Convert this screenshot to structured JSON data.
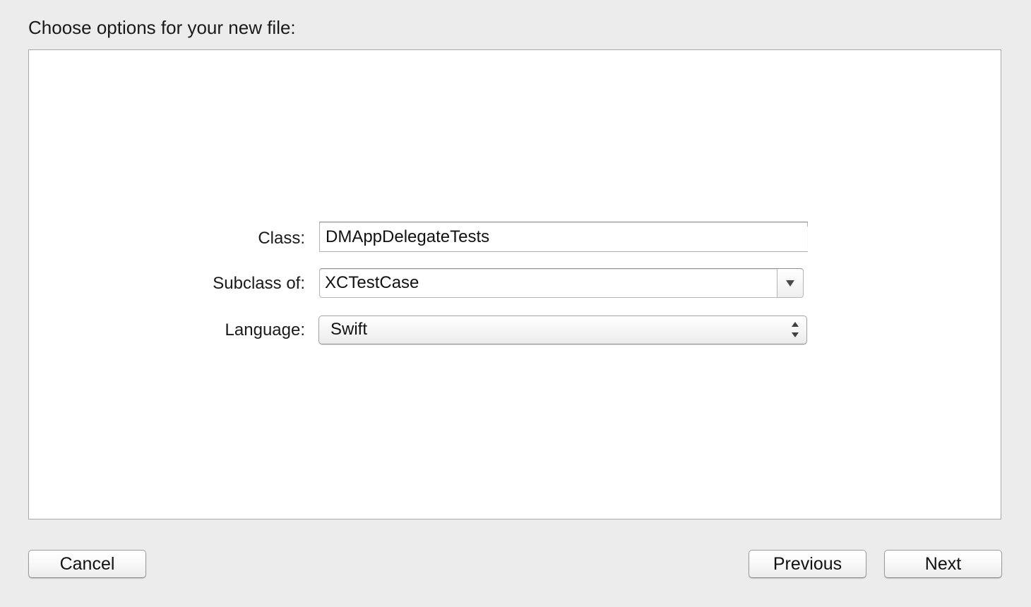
{
  "sheet": {
    "title": "Choose options for your new file:"
  },
  "form": {
    "class_label": "Class:",
    "class_value": "DMAppDelegateTests",
    "subclass_label": "Subclass of:",
    "subclass_value": "XCTestCase",
    "language_label": "Language:",
    "language_value": "Swift"
  },
  "buttons": {
    "cancel": "Cancel",
    "previous": "Previous",
    "next": "Next"
  },
  "icons": {
    "combo_arrow": "chevron-down-icon",
    "popup_arrows": "up-down-arrows-icon"
  },
  "colors": {
    "window_background": "#ececec",
    "panel_background": "#ffffff",
    "panel_border": "#a9a9a9"
  }
}
